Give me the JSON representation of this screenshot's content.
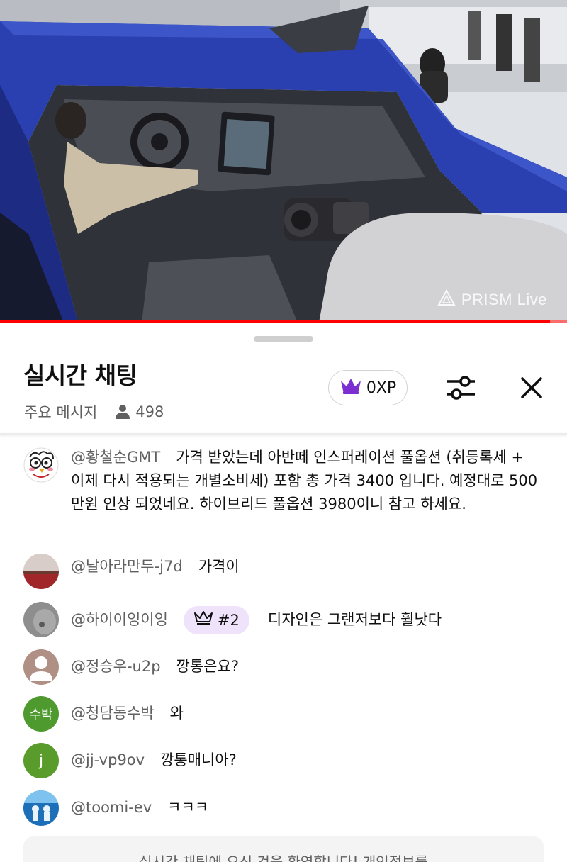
{
  "video": {
    "watermark": "PRISM Live",
    "progress_fraction": 0.97
  },
  "chat": {
    "title": "실시간 채팅",
    "mode_label": "주요 메시지",
    "viewer_count": "498",
    "xp_label": "0XP",
    "icons": {
      "viewers": "person-icon",
      "xp": "crown-icon",
      "filter": "sliders-icon",
      "close": "close-icon"
    }
  },
  "messages": [
    {
      "author": "@황철순GMT",
      "text": "가격 받았는데 아반떼 인스퍼레이션 풀옵션 (취등록세 + 이제 다시 적용되는 개별소비세) 포함 총 가격 3400 입니다. 예정대로 500만원 인상 되었네요. 하이브리드 풀옵션 3980이니 참고 하세요.",
      "avatar": "cartoon-avatar"
    },
    {
      "author": "@날아라만두-j7d",
      "text": "가격이",
      "avatar": "sunset-photo-avatar"
    },
    {
      "author": "@하이이잉이잉",
      "badge": "#2",
      "text": "디자인은 그랜저보다 훨낫다",
      "avatar": "gray-photo-avatar"
    },
    {
      "author": "@정승우-u2p",
      "text": "깡통은요?",
      "avatar": "default-person-avatar"
    },
    {
      "author": "@청담동수박",
      "text": "와",
      "avatar_text": "수박",
      "avatar_color": "#4e9a2f"
    },
    {
      "author": "@jj-vp9ov",
      "text": "깡통매니아?",
      "avatar_text": "j",
      "avatar_color": "#5a9c2b"
    },
    {
      "author": "@toomi-ev",
      "text": "ㅋㅋㅋ",
      "avatar": "blue-photo-avatar"
    }
  ],
  "composer": {
    "notice": "실시간 채팅에 오신 것을 환영합니다! 개인정보를"
  },
  "colors": {
    "accent_red": "#ff0000",
    "crown_purple": "#7b2fd0",
    "badge_bg": "#efe3fb",
    "secondary_text": "#606060"
  }
}
